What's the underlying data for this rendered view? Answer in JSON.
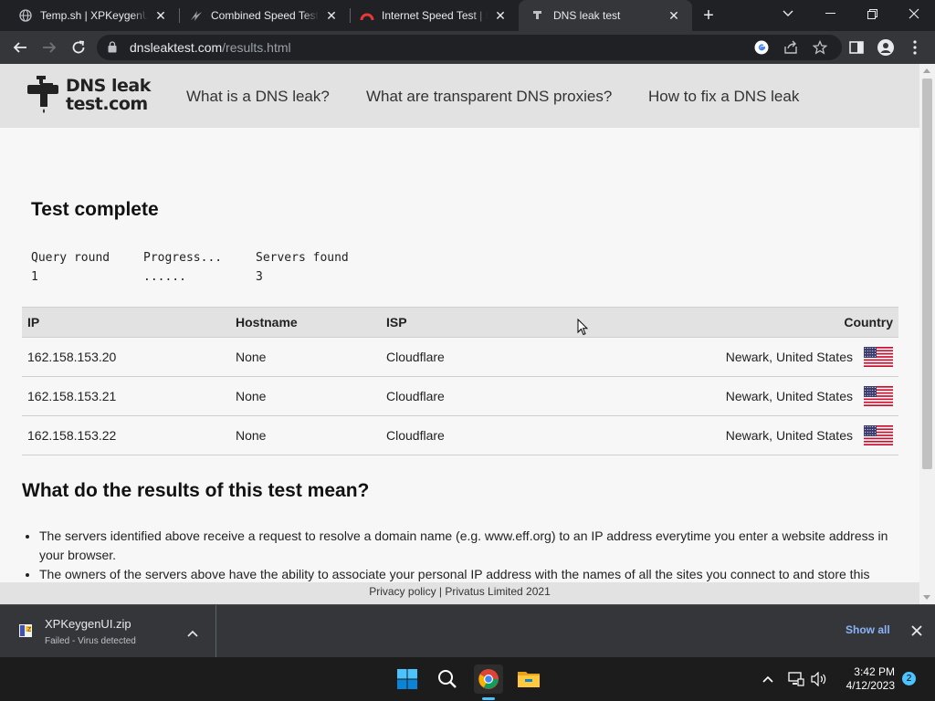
{
  "browser": {
    "tabs": [
      {
        "title": "Temp.sh | XPKeygenUI.z",
        "icon": "globe-icon"
      },
      {
        "title": "Combined Speed Test F",
        "icon": "lightning-icon"
      },
      {
        "title": "Internet Speed Test | Fa",
        "icon": "gauge-icon"
      },
      {
        "title": "DNS leak test",
        "icon": "faucet-icon",
        "active": true
      }
    ],
    "url_domain": "dnsleaktest.com",
    "url_path": "/results.html"
  },
  "site": {
    "logo_line1": "DNS leak",
    "logo_line2": "test.com",
    "nav": [
      "What is a DNS leak?",
      "What are transparent DNS proxies?",
      "How to fix a DNS leak"
    ]
  },
  "test": {
    "title": "Test complete",
    "stats": [
      {
        "label": "Query round",
        "value": "1"
      },
      {
        "label": "Progress...",
        "value": "......"
      },
      {
        "label": "Servers found",
        "value": "3"
      }
    ]
  },
  "table": {
    "headers": [
      "IP",
      "Hostname",
      "ISP",
      "Country"
    ],
    "rows": [
      {
        "ip": "162.158.153.20",
        "hostname": "None",
        "isp": "Cloudflare",
        "country": "Newark, United States"
      },
      {
        "ip": "162.158.153.21",
        "hostname": "None",
        "isp": "Cloudflare",
        "country": "Newark, United States"
      },
      {
        "ip": "162.158.153.22",
        "hostname": "None",
        "isp": "Cloudflare",
        "country": "Newark, United States"
      }
    ]
  },
  "explanation": {
    "heading": "What do the results of this test mean?",
    "items": [
      "The servers identified above receive a request to resolve a domain name (e.g. www.eff.org) to an IP address everytime you enter a website address in your browser.",
      "The owners of the servers above have the ability to associate your personal IP address with the names of all the sites you connect to and store this"
    ]
  },
  "footer": {
    "text": "Privacy policy | Privatus Limited 2021"
  },
  "download": {
    "filename": "XPKeygenUI.zip",
    "status": "Failed - Virus detected",
    "show_all": "Show all"
  },
  "taskbar": {
    "time": "3:42 PM",
    "date": "4/12/2023",
    "notifications": "2"
  },
  "colors": {
    "accent_blue": "#8ab4f8",
    "windows_accent": "#4cc2ff",
    "header_gray": "#e2e2e2"
  }
}
